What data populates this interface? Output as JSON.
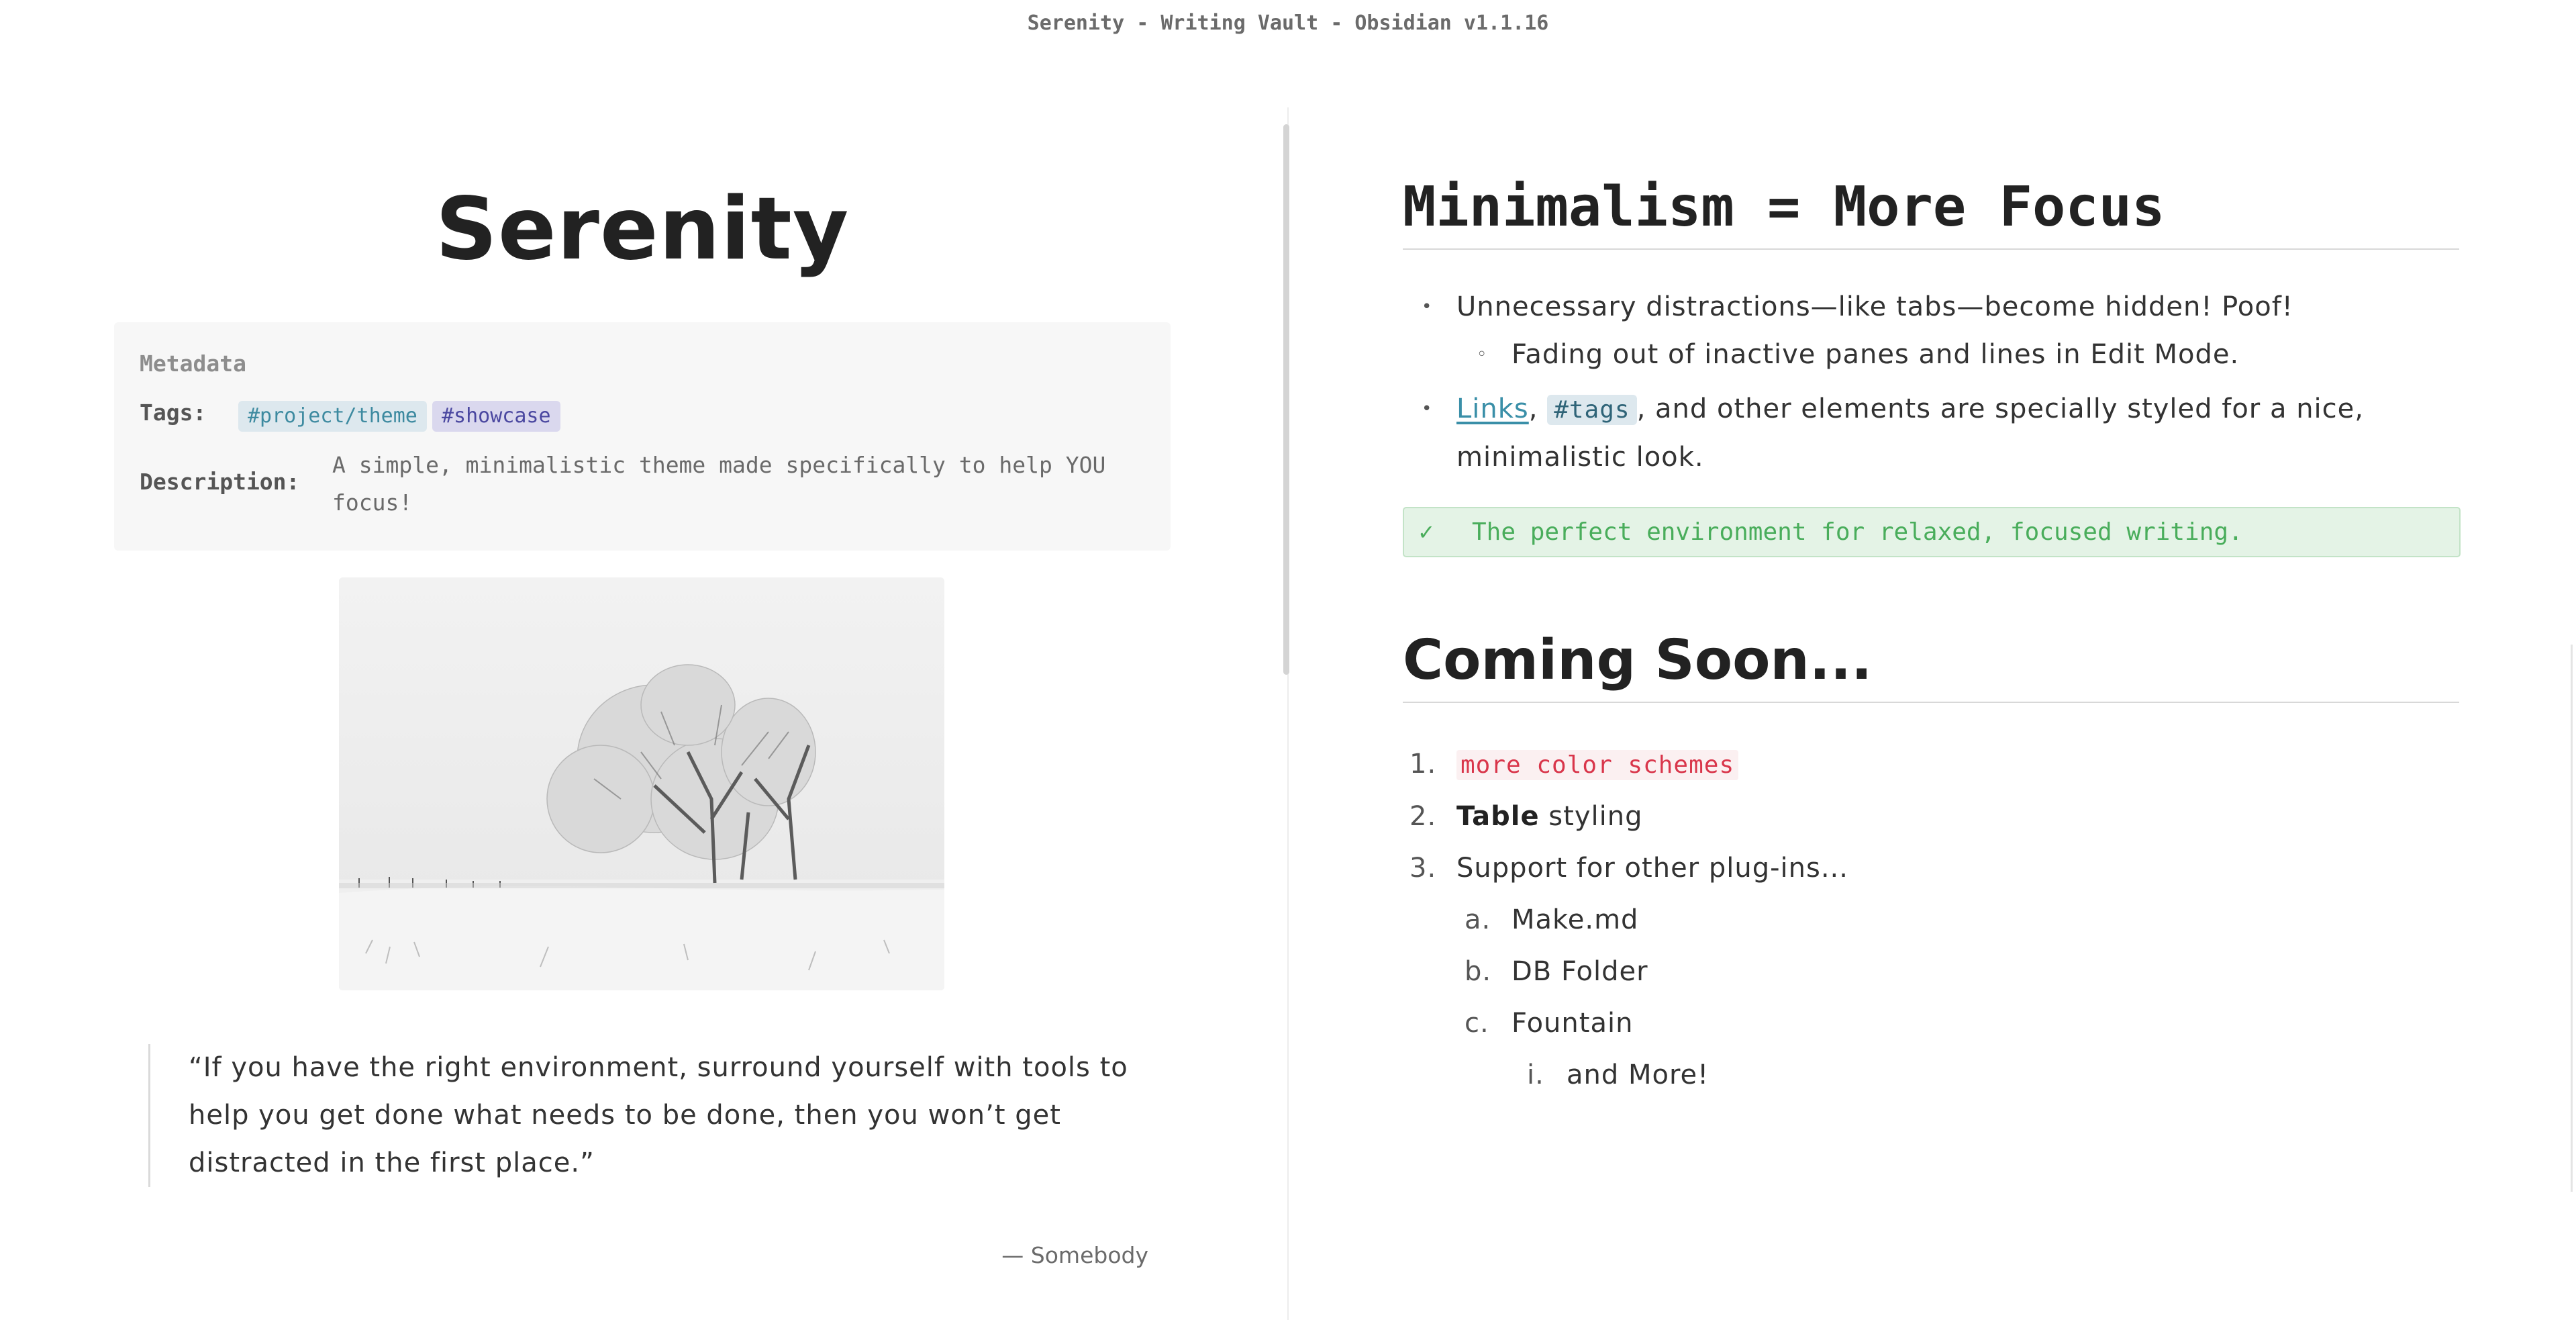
{
  "window": {
    "title": "Serenity - Writing Vault - Obsidian v1.1.16"
  },
  "left_pane": {
    "note_title": "Serenity",
    "metadata": {
      "heading": "Metadata",
      "tags_label": "Tags:",
      "tags": [
        "#project/theme",
        "#showcase"
      ],
      "description_label": "Description:",
      "description": "A simple, minimalistic theme made specifically to help YOU focus!"
    },
    "image": {
      "icon": "snowy-tree-landscape"
    },
    "quote": {
      "text": "“If you have the right environment, surround yourself with tools to help you get done what needs to be done, then you won’t get distracted in the first place.”",
      "attribution": "— Somebody"
    }
  },
  "right_pane": {
    "heading1": "Minimalism = More Focus",
    "bullets": {
      "item1": "Unnecessary distractions—like tabs—become hidden! Poof!",
      "item1_sub": "Fading out of inactive panes and lines in Edit Mode.",
      "item2_link": "Links",
      "item2_sep": ", ",
      "item2_tag": "#tags",
      "item2_rest": ", and other elements are specially styled for a nice, minimalistic look."
    },
    "callout": {
      "icon": "check-icon",
      "text": "The perfect environment for relaxed, focused writing.",
      "color": "#49ad5b"
    },
    "heading2": "Coming Soon...",
    "ordered": {
      "n1": "1.",
      "item1_code": "more color schemes",
      "n2": "2.",
      "item2_bold": "Table",
      "item2_rest": " styling",
      "n3": "3.",
      "item3": "Support for other plug-ins...",
      "na": "a.",
      "sub_a": "Make.md",
      "nb": "b.",
      "sub_b": "DB Folder",
      "nc": "c.",
      "sub_c": "Fountain",
      "ni": "i.",
      "sub_c_i": "and More!"
    }
  }
}
